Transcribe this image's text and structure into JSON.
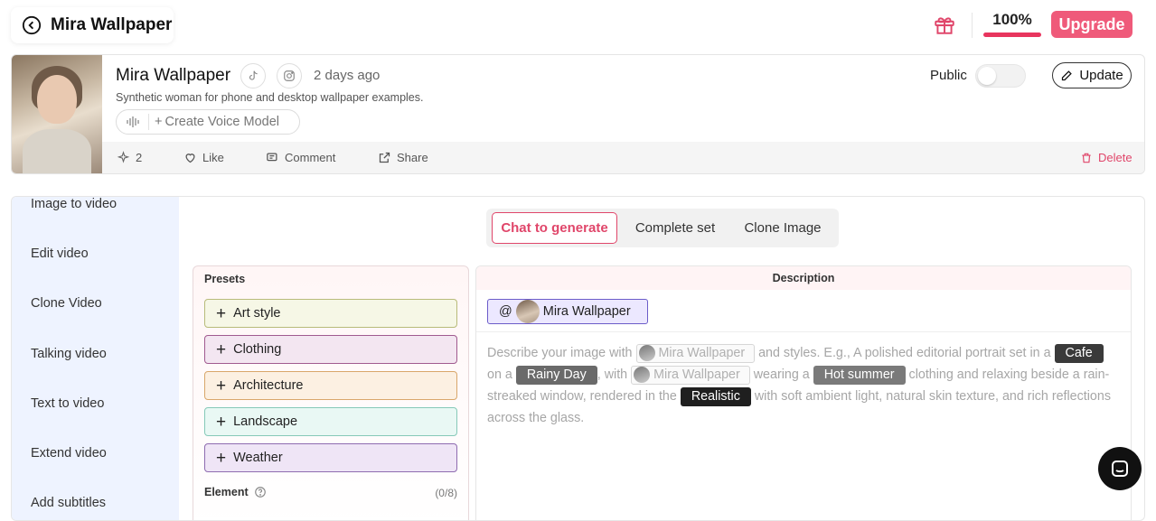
{
  "header": {
    "title": "Mira Wallpaper",
    "credits": "100%",
    "upgrade_label": "Upgrade"
  },
  "profile": {
    "name": "Mira Wallpaper",
    "time_ago": "2 days ago",
    "description": "Synthetic woman for phone and desktop wallpaper examples.",
    "voice_label": "Create Voice Model",
    "public_label": "Public",
    "public_enabled": false,
    "update_label": "Update",
    "footer": {
      "generations": "2",
      "like": "Like",
      "comment": "Comment",
      "share": "Share",
      "delete": "Delete"
    }
  },
  "sidebar": {
    "items": [
      {
        "label": "Image to video"
      },
      {
        "label": "Edit video"
      },
      {
        "label": "Clone Video"
      },
      {
        "label": "Talking video"
      },
      {
        "label": "Text to video"
      },
      {
        "label": "Extend video"
      },
      {
        "label": "Add subtitles"
      }
    ]
  },
  "tabs": [
    {
      "label": "Chat to generate",
      "active": true
    },
    {
      "label": "Complete set",
      "active": false
    },
    {
      "label": "Clone Image",
      "active": false
    }
  ],
  "presets": {
    "title": "Presets",
    "items": [
      {
        "label": "Art style",
        "bg": "#f6f7e6",
        "border": "#b8bb7a"
      },
      {
        "label": "Clothing",
        "bg": "#f3e6f1",
        "border": "#a05a8f"
      },
      {
        "label": "Architecture",
        "bg": "#fcf0e2",
        "border": "#d9a76b"
      },
      {
        "label": "Landscape",
        "bg": "#e9f8f4",
        "border": "#86c9b8"
      },
      {
        "label": "Weather",
        "bg": "#efe5f6",
        "border": "#8e6bb0"
      }
    ],
    "element_label": "Element",
    "element_count": "(0/8)"
  },
  "description": {
    "title": "Description",
    "mention_at": "@",
    "mention_name": "Mira Wallpaper",
    "placeholder": {
      "t1": "Describe your image with",
      "chip1": "Mira Wallpaper",
      "t2": "and styles. E.g., A polished editorial portrait set in a",
      "cafe": "Cafe",
      "t3": "on a",
      "rainy": "Rainy Day",
      "t4": ", with",
      "chip2": "Mira Wallpaper",
      "t5": "wearing a",
      "hot": "Hot summer",
      "t6": "clothing and relaxing beside a rain-streaked window, rendered in the",
      "realistic": "Realistic",
      "t7": "with soft ambient light, natural skin texture, and rich reflections across the glass."
    }
  },
  "colors": {
    "accent": "#e0466a",
    "upgrade": "#ef5a7a",
    "sidebar_bg": "#eef3ff"
  }
}
